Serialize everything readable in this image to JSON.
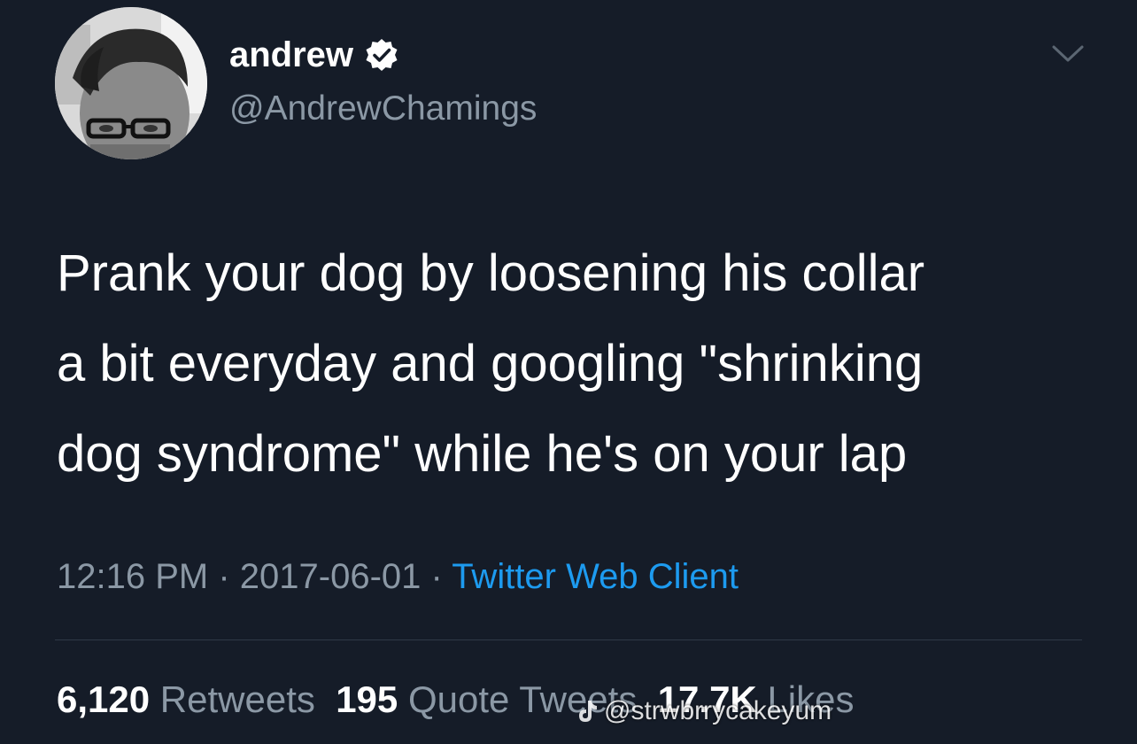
{
  "author": {
    "display_name": "andrew",
    "handle": "@AndrewChamings",
    "verified_icon": "verified-badge-icon",
    "avatar_icon": "profile-photo"
  },
  "tweet": {
    "text": "Prank your dog by loosening his collar\na bit everyday and googling \"shrinking\ndog syndrome\" while he's on your lap",
    "time": "12:16 PM",
    "separator": " · ",
    "date": "2017-06-01",
    "source": "Twitter Web Client"
  },
  "stats": {
    "retweets_count": "6,120",
    "retweets_label": "Retweets",
    "quotes_count": "195",
    "quotes_label": "Quote Tweets",
    "likes_count": "17.7K",
    "likes_label": "Likes"
  },
  "watermark": {
    "text": "@strwbrrycakeyum",
    "icon": "tiktok-icon"
  },
  "colors": {
    "background": "#151c28",
    "text_primary": "#ffffff",
    "text_secondary": "#8b98a5",
    "link": "#1d9bf0",
    "divider": "#2f3a47"
  }
}
